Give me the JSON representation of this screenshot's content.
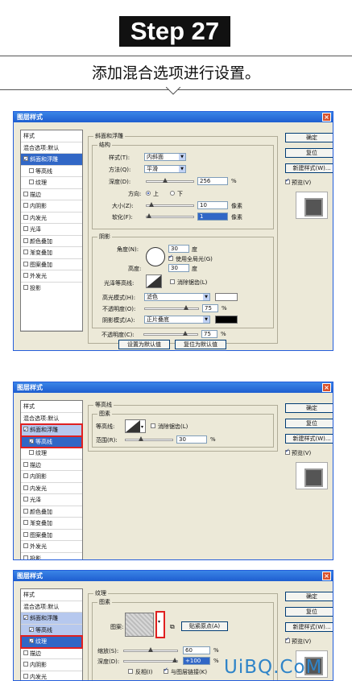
{
  "header": {
    "step": "Step 27",
    "subtitle": "添加混合选项进行设置。"
  },
  "dialog": {
    "title": "图层样式",
    "close_icon": "close-icon"
  },
  "buttons": {
    "ok": "确定",
    "reset": "复位",
    "new_style": "新建样式(W)...",
    "preview": "预览(V)"
  },
  "left_list": {
    "header": "样式",
    "blend": "混合选项:默认",
    "bevel": "斜面和浮雕",
    "contour": "等高线",
    "texture": "纹理",
    "stroke": "描边",
    "inner_shadow": "内阴影",
    "inner_glow": "内发光",
    "satin": "光泽",
    "color_overlay": "颜色叠加",
    "gradient_overlay": "渐变叠加",
    "pattern_overlay": "图案叠加",
    "outer_glow": "外发光",
    "drop_shadow": "投影"
  },
  "panel1": {
    "group_title": "斜面和浮雕",
    "structure_title": "结构",
    "style_label": "样式(T):",
    "style_value": "内斜面",
    "technique_label": "方法(Q):",
    "technique_value": "平滑",
    "depth_label": "深度(D):",
    "depth_value": "256",
    "depth_unit": "%",
    "direction_label": "方向:",
    "dir_up": "上",
    "dir_down": "下",
    "size_label": "大小(Z):",
    "size_value": "10",
    "size_unit": "像素",
    "soften_label": "软化(F):",
    "soften_value": "1",
    "soften_unit": "像素",
    "shading_title": "阴影",
    "angle_label": "角度(N):",
    "angle_value": "30",
    "angle_unit": "度",
    "global_light": "使用全局光(G)",
    "altitude_label": "高度:",
    "altitude_value": "30",
    "altitude_unit": "度",
    "gloss_label": "光泽等高线:",
    "antialias": "消除锯齿(L)",
    "highlight_label": "高光模式(H):",
    "highlight_value": "滤色",
    "opacity1_label": "不透明度(O):",
    "opacity1_value": "75",
    "shadow_mode_label": "阴影模式(A):",
    "shadow_mode_value": "正片叠底",
    "opacity2_label": "不透明度(C):",
    "opacity2_value": "75",
    "pct": "%",
    "make_default": "设置为默认值",
    "reset_default": "复位为默认值",
    "highlight_color": "#ffffff",
    "shadow_color": "#000000"
  },
  "panel2": {
    "group_title": "等高线",
    "elements_title": "图素",
    "contour_label": "等高线:",
    "antialias": "消除锯齿(L)",
    "range_label": "范围(R):",
    "range_value": "30",
    "range_unit": "%"
  },
  "panel3": {
    "group_title": "纹理",
    "elements_title": "图素",
    "pattern_label": "图案:",
    "snap_origin": "贴紧原点(A)",
    "scale_label": "缩放(S):",
    "scale_value": "60",
    "depth_label": "深度(D):",
    "depth_value": "+100",
    "pct": "%",
    "invert": "反相(I)",
    "link": "与图层链接(K)"
  },
  "watermark": "UiBQ.CoM",
  "colors": {
    "accent": "#3167c6",
    "titlebar": "#1e5ed0",
    "highlight_red": "#e02020"
  }
}
